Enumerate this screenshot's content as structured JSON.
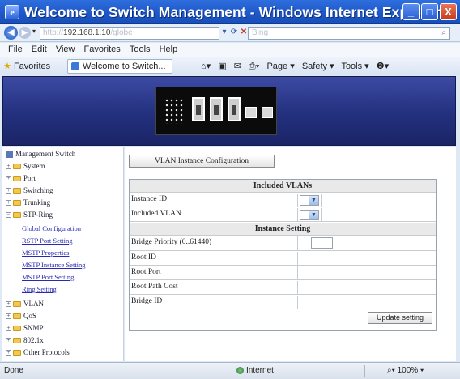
{
  "window": {
    "title": "Welcome to Switch Management - Windows Internet Explorer",
    "minimize": "_",
    "maximize": "□",
    "close": "X"
  },
  "address_bar": {
    "url_prefix": "http://",
    "url": "192.168.1.10",
    "url_suffix": "/globe",
    "search_placeholder": "Bing"
  },
  "menu": {
    "items": [
      "File",
      "Edit",
      "View",
      "Favorites",
      "Tools",
      "Help"
    ]
  },
  "favorites_bar": {
    "favorites_label": "Favorites",
    "tab_label": "Welcome to Switch...",
    "commands": [
      "Page ▾",
      "Safety ▾",
      "Tools ▾",
      "❷▾"
    ]
  },
  "sidebar": {
    "root": "Management Switch",
    "items_top": [
      "System",
      "Port",
      "Switching",
      "Trunking",
      "STP-Ring"
    ],
    "stp_links": [
      "Global Configuration",
      "RSTP Port Setting",
      "MSTP Properties",
      "MSTP Instance Setting",
      "MSTP Port Setting",
      "Ring Setting"
    ],
    "items_bottom": [
      "VLAN",
      "QoS",
      "SNMP",
      "802.1x",
      "Other Protocols"
    ]
  },
  "main": {
    "config_button": "VLAN Instance Configuration",
    "included_vlans_header": "Included VLANs",
    "instance_id_label": "Instance ID",
    "included_vlan_label": "Included VLAN",
    "instance_setting_header": "Instance Setting",
    "bridge_priority_label": "Bridge Priority (0..61440)",
    "root_id_label": "Root ID",
    "root_port_label": "Root Port",
    "root_path_cost_label": "Root Path Cost",
    "bridge_id_label": "Bridge ID",
    "update_button": "Update setting"
  },
  "status_bar": {
    "status": "Done",
    "zone": "Internet",
    "zoom": "100%"
  },
  "colors": {
    "titlebar": "#1d56c6",
    "banner": "#23307e",
    "link": "#2a2ab0"
  }
}
